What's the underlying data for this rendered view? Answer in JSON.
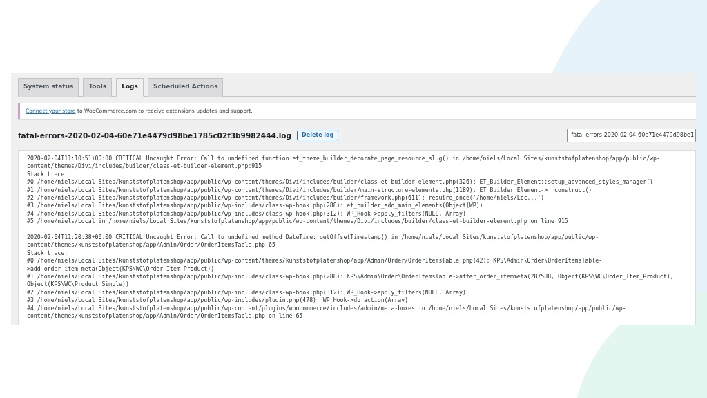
{
  "tabs": [
    {
      "label": "System status",
      "selected": false
    },
    {
      "label": "Tools",
      "selected": false
    },
    {
      "label": "Logs",
      "selected": true
    },
    {
      "label": "Scheduled Actions",
      "selected": false
    }
  ],
  "notice": {
    "link": "Connect your store",
    "text": "to WooCommerce.com to receive extensions updates and support."
  },
  "log_title": "fatal-errors-2020-02-04-60e71e4479d98be1785c02f3b9982444.log",
  "delete_button": "Delete log",
  "log_select": {
    "value": "fatal-errors-2020-02-04-60e71e4479d98be1"
  },
  "log_entries": [
    {
      "lines": [
        "2020-02-04T11:10:51+00:00 CRITICAL Uncaught Error: Call to undefined function et_theme_builder_decorate_page_resource_slug() in /home/niels/Local Sites/kunststofplatenshop/app/public/wp-",
        "content/themes/Divi/includes/builder/class-et-builder-element.php:915",
        "Stack trace:",
        "#0 /home/niels/Local Sites/kunststofplatenshop/app/public/wp-content/themes/Divi/includes/builder/class-et-builder-element.php(326): ET_Builder_Element::setup_advanced_styles_manager()",
        "#1 /home/niels/Local Sites/kunststofplatenshop/app/public/wp-content/themes/Divi/includes/builder/main-structure-elements.php(1189): ET_Builder_Element->__construct()",
        "#2 /home/niels/Local Sites/kunststofplatenshop/app/public/wp-content/themes/Divi/includes/builder/framework.php(611): require_once('/home/niels/Loc...')",
        "#3 /home/niels/Local Sites/kunststofplatenshop/app/public/wp-includes/class-wp-hook.php(288): et_builder_add_main_elements(Object(WP))",
        "#4 /home/niels/Local Sites/kunststofplatenshop/app/public/wp-includes/class-wp-hook.php(312): WP_Hook->apply_filters(NULL, Array)",
        "#5 /home/niels/Local in /home/niels/Local Sites/kunststofplatenshop/app/public/wp-content/themes/Divi/includes/builder/class-et-builder-element.php on line 915"
      ]
    },
    {
      "lines": [
        "2020-02-04T11:20:38+00:00 CRITICAL Uncaught Error: Call to undefined method DateTime::getOffsetTimestamp() in /home/niels/Local Sites/kunststofplatenshop/app/public/wp-",
        "content/themes/kunststofplatenshop/app/Admin/Order/OrderItemsTable.php:65",
        "Stack trace:",
        "#0 /home/niels/Local Sites/kunststofplatenshop/app/public/wp-content/themes/kunststofplatenshop/app/Admin/Order/OrderItemsTable.php(42): KPS\\Admin\\Order\\OrderItemsTable-",
        ">add_order_item_meta(Object(KPS\\WC\\Order_Item_Product))",
        "#1 /home/niels/Local Sites/kunststofplatenshop/app/public/wp-includes/class-wp-hook.php(288): KPS\\Admin\\Order\\OrderItemsTable->after_order_itemmeta(287588, Object(KPS\\WC\\Order_Item_Product),",
        "Object(KPS\\WC\\Product_Simple))",
        "#2 /home/niels/Local Sites/kunststofplatenshop/app/public/wp-includes/class-wp-hook.php(312): WP_Hook->apply_filters(NULL, Array)",
        "#3 /home/niels/Local Sites/kunststofplatenshop/app/public/wp-includes/plugin.php(478): WP_Hook->do_action(Array)",
        "#4 /home/niels/Local Sites/kunststofplatenshop/app/public/wp-content/plugins/woocommerce/includes/admin/meta-boxes in /home/niels/Local Sites/kunststofplatenshop/app/public/wp-",
        "content/themes/kunststofplatenshop/app/Admin/Order/OrderItemsTable.php on line 65"
      ]
    }
  ]
}
